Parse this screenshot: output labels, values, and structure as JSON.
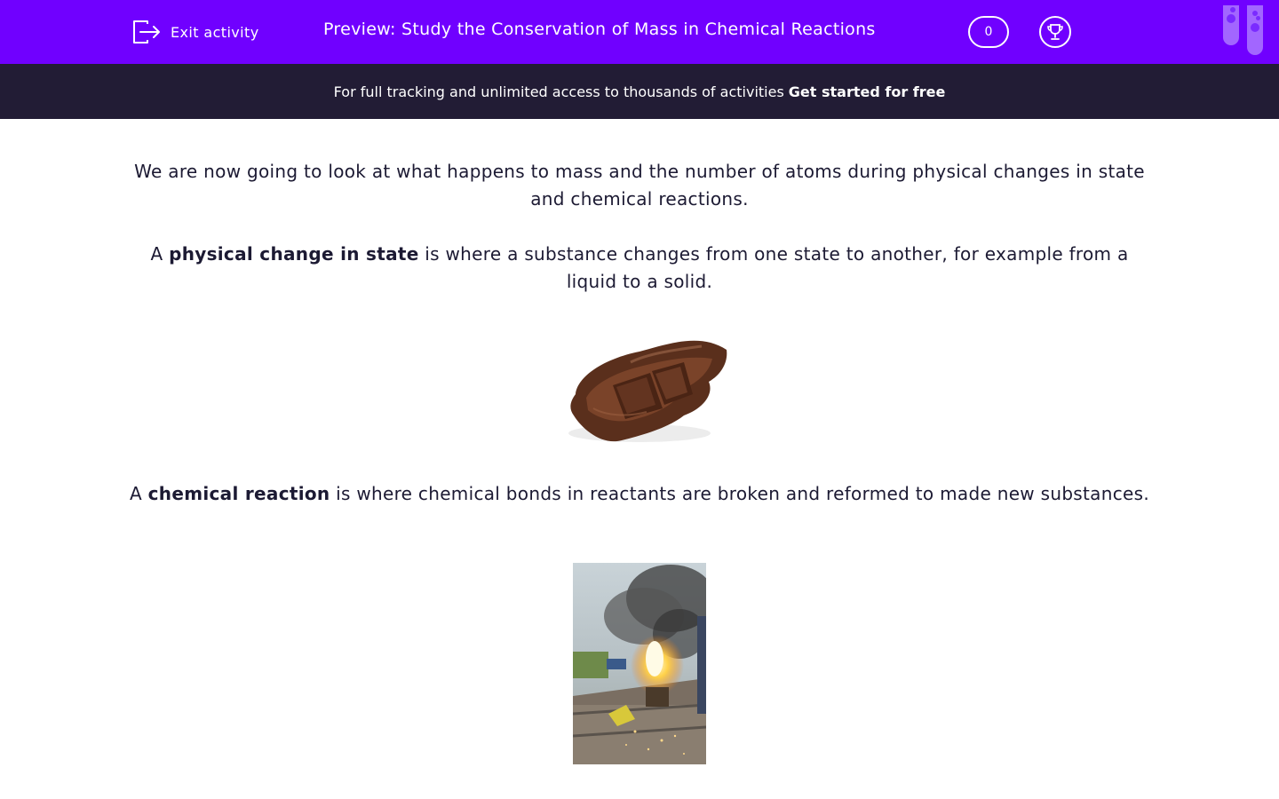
{
  "header": {
    "exit_label": "Exit activity",
    "title": "Preview: Study the Conservation of Mass in Chemical Reactions",
    "score": "0",
    "colors": {
      "bar": "#7000ff",
      "text": "#ffffff"
    }
  },
  "banner": {
    "text": "For full tracking and unlimited access to thousands of activities",
    "cta": "Get started for free"
  },
  "content": {
    "intro": "We are now going to look at what happens to mass and the number of atoms during physical changes in state and chemical reactions.",
    "physical": {
      "prefix": "A ",
      "term": "physical change in state",
      "rest": " is where a substance changes from one state to another, for example from a liquid to a solid."
    },
    "chemical": {
      "prefix": "A ",
      "term": "chemical reaction",
      "rest": " is where chemical bonds in reactants are broken and reformed to made new substances."
    },
    "images": {
      "first": "melted-chocolate",
      "second": "thermite-welding-fire"
    }
  },
  "icons": {
    "exit": "exit-icon",
    "trophy": "trophy-icon",
    "tubes": "test-tubes-icon"
  }
}
